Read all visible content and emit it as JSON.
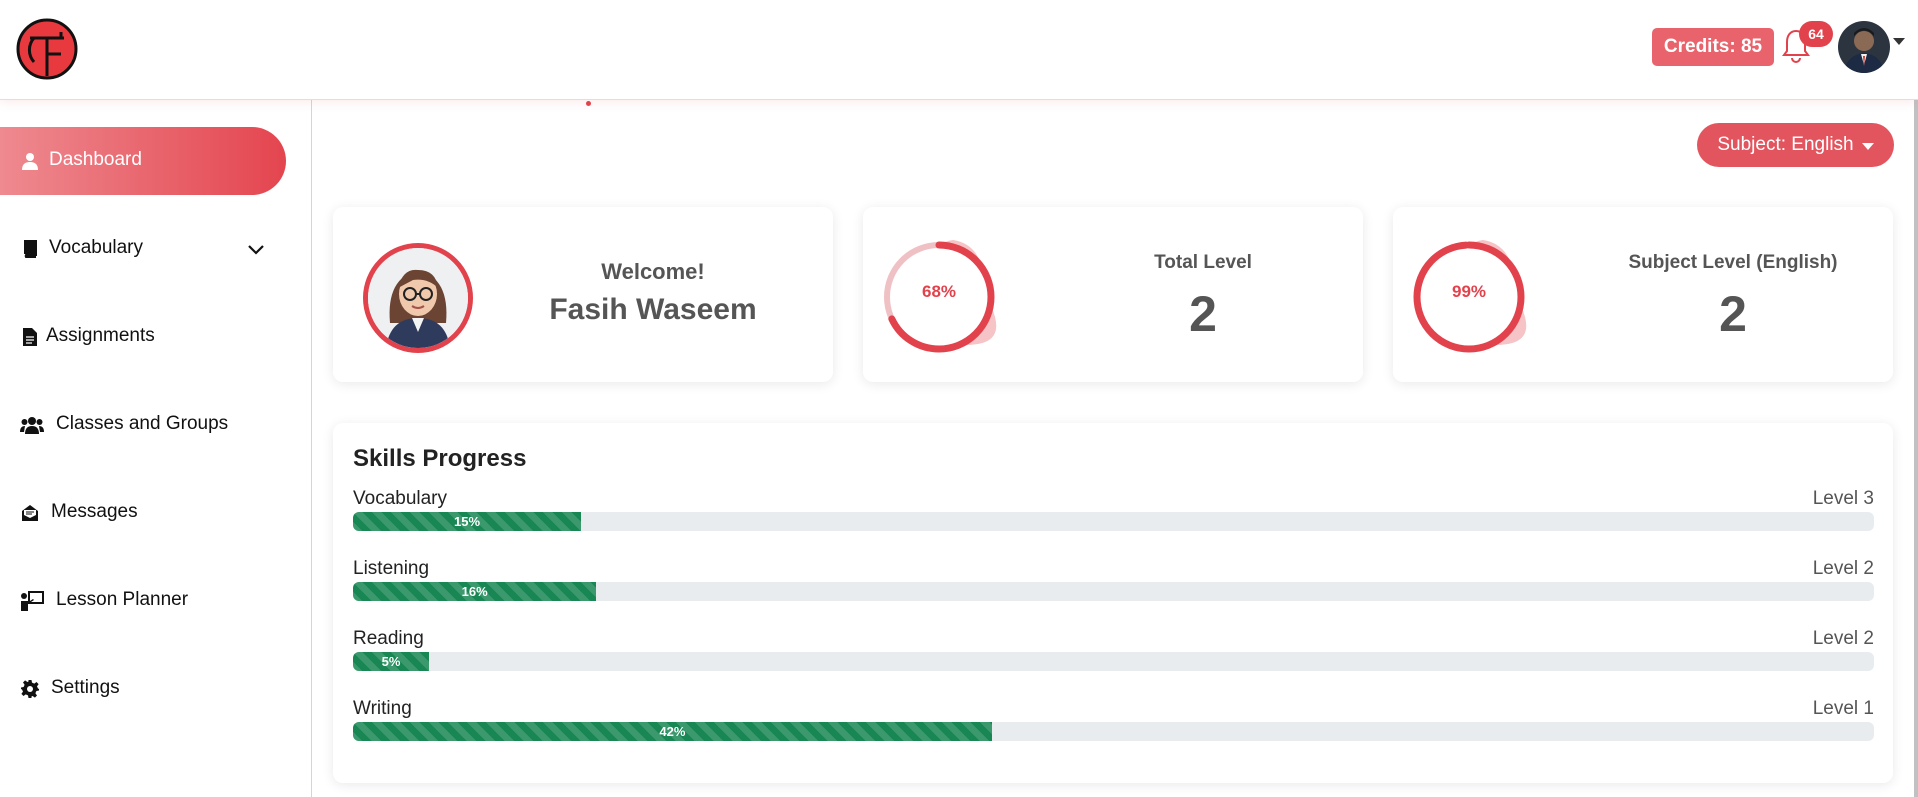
{
  "header": {
    "logo_icon": "tf-logo",
    "credits_label": "Credits: 85",
    "notifications_count": "64",
    "bell_icon": "bell-icon",
    "accent_color": "#e2424c"
  },
  "sidebar": {
    "items": [
      {
        "label": "Dashboard",
        "icon": "user-icon",
        "active": true
      },
      {
        "label": "Vocabulary",
        "icon": "book-icon",
        "expandable": true
      },
      {
        "label": "Assignments",
        "icon": "file-icon"
      },
      {
        "label": "Classes and Groups",
        "icon": "users-icon"
      },
      {
        "label": "Messages",
        "icon": "envelope-icon"
      },
      {
        "label": "Lesson Planner",
        "icon": "teacher-board-icon"
      },
      {
        "label": "Settings",
        "icon": "gear-icon"
      }
    ]
  },
  "main": {
    "subject_button": "Subject: English",
    "welcome": {
      "label": "Welcome!",
      "name": "Fasih Waseem"
    },
    "total_level": {
      "title": "Total Level",
      "value": "2",
      "percent_label": "68%",
      "percent": 68
    },
    "subject_level": {
      "title": "Subject Level (English)",
      "value": "2",
      "percent_label": "99%",
      "percent": 99
    },
    "skills": {
      "title": "Skills Progress",
      "items": [
        {
          "name": "Vocabulary",
          "level": "Level 3",
          "percent_label": "15%",
          "percent": 15
        },
        {
          "name": "Listening",
          "level": "Level 2",
          "percent_label": "16%",
          "percent": 16
        },
        {
          "name": "Reading",
          "level": "Level 2",
          "percent_label": "5%",
          "percent": 5
        },
        {
          "name": "Writing",
          "level": "Level 1",
          "percent_label": "42%",
          "percent": 42
        }
      ],
      "bar_color": "#198754"
    }
  }
}
